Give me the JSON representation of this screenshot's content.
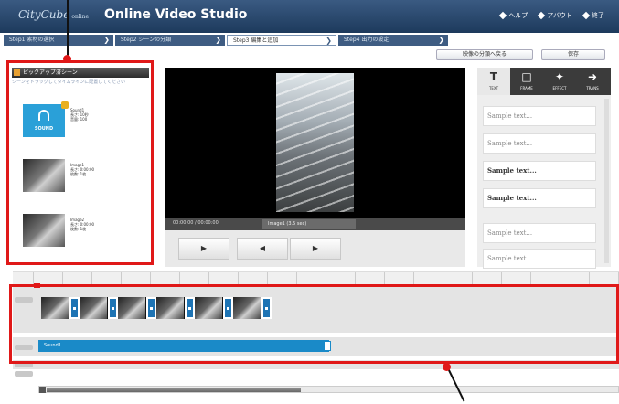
{
  "app": {
    "logo": "CityCube",
    "logo_sub": "online",
    "title": "Online Video Studio"
  },
  "toplinks": [
    {
      "label": "ヘルプ",
      "icon": "diamond-icon"
    },
    {
      "label": "アバウト",
      "icon": "diamond-icon"
    },
    {
      "label": "終了",
      "icon": "diamond-icon"
    }
  ],
  "steps": [
    {
      "label": "Step1 素材の選択",
      "active": false
    },
    {
      "label": "Step2 シーンの分類",
      "active": false
    },
    {
      "label": "Step3 編集と追加",
      "active": true
    },
    {
      "label": "Step4 出力の設定",
      "active": false
    }
  ],
  "sub_buttons": {
    "first": "映像の分類へ戻る",
    "second": "保存"
  },
  "left_panel": {
    "title": "ピックアップ済シーン",
    "description": "シーンをドラッグしてタイムラインに配置してください",
    "items": [
      {
        "kind": "sound",
        "thumb_label": "SOUND",
        "meta": [
          "Sound1",
          "長さ: 10秒",
          "音量: 100"
        ]
      },
      {
        "kind": "image",
        "meta": [
          "Image1",
          "長さ: 0:00:00",
          "枚数: 1枚"
        ]
      },
      {
        "kind": "image",
        "meta": [
          "Image2",
          "長さ: 0:00:00",
          "枚数: 1枚"
        ]
      }
    ]
  },
  "preview": {
    "time": "00:00:00 / 00:00:00",
    "clip_name": "Image1 (3.5 sec)"
  },
  "controls": {
    "play": "▶",
    "prev": "◀",
    "next": "▶"
  },
  "tool_tabs": [
    {
      "glyph": "T",
      "label": "TEXT",
      "active": true
    },
    {
      "glyph": "□",
      "label": "FRAME",
      "active": false
    },
    {
      "glyph": "✦",
      "label": "EFFECT",
      "active": false
    },
    {
      "glyph": "➜",
      "label": "TRANS",
      "active": false
    }
  ],
  "samples": [
    {
      "text": "Sample text...",
      "bold": false
    },
    {
      "text": "Sample text...",
      "bold": false
    },
    {
      "text": "Sample text...",
      "bold": true
    },
    {
      "text": "Sample text...",
      "bold": true
    },
    {
      "text": "Sample text...",
      "bold": false
    },
    {
      "text": "Sample text...",
      "bold": false
    }
  ],
  "timeline": {
    "clip_count": 6,
    "audio_label": "Sound1"
  }
}
